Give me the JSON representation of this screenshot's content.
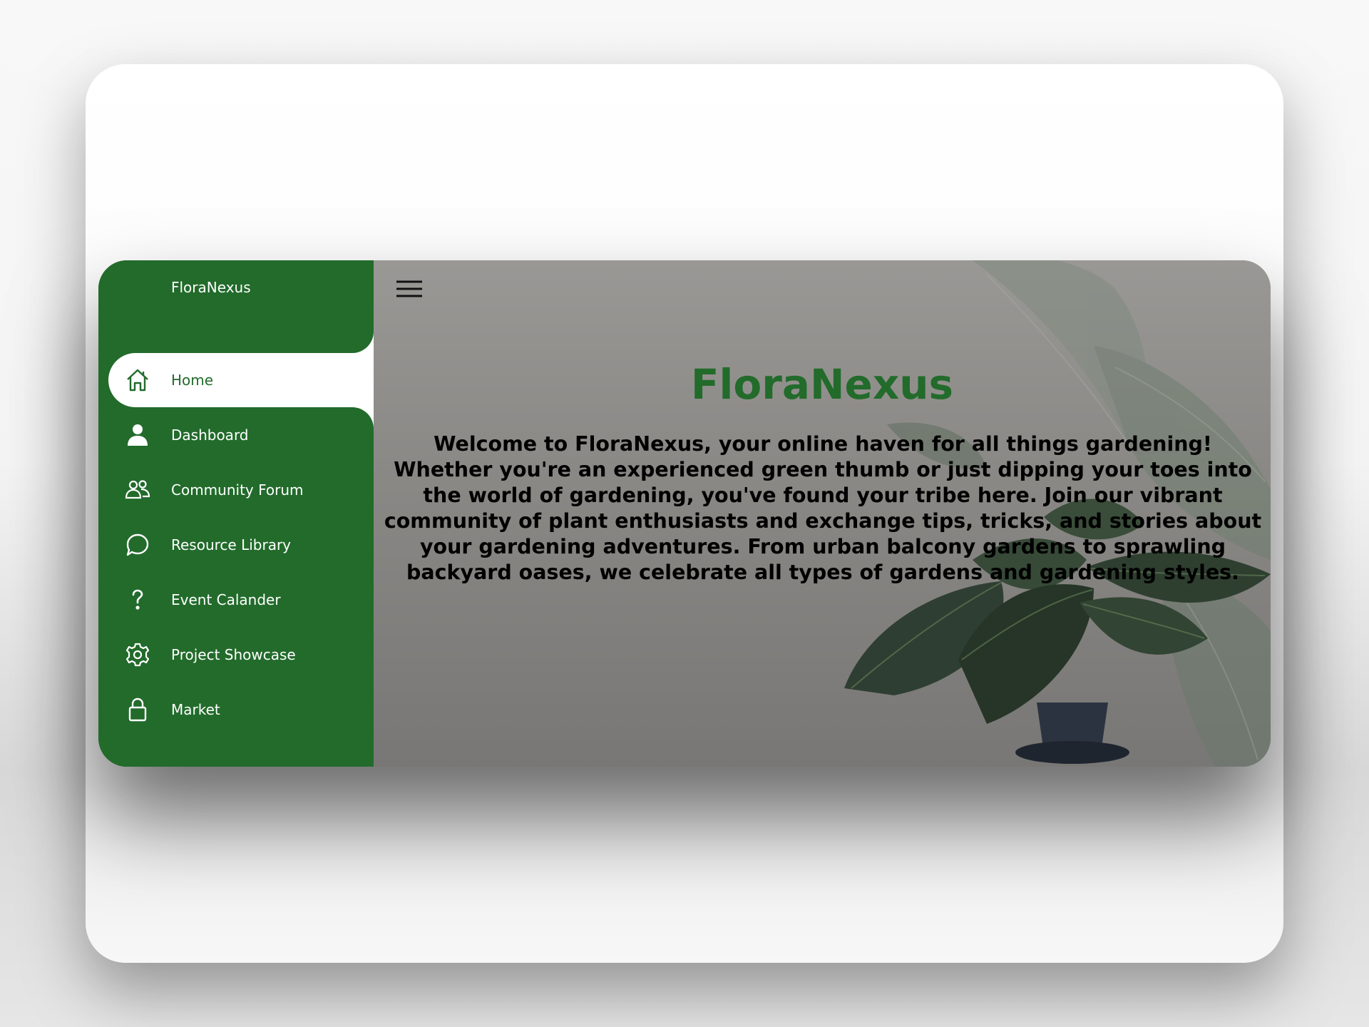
{
  "sidebar": {
    "brand": "FloraNexus",
    "items": [
      {
        "label": "Home",
        "icon": "home-icon",
        "active": true
      },
      {
        "label": "Dashboard",
        "icon": "user-icon",
        "active": false
      },
      {
        "label": "Community Forum",
        "icon": "users-icon",
        "active": false
      },
      {
        "label": "Resource Library",
        "icon": "chat-bubble-icon",
        "active": false
      },
      {
        "label": "Event Calander",
        "icon": "question-icon",
        "active": false
      },
      {
        "label": "Project Showcase",
        "icon": "gear-icon",
        "active": false
      },
      {
        "label": "Market",
        "icon": "lock-icon",
        "active": false
      }
    ]
  },
  "main": {
    "menu_icon": "hamburger-menu-icon",
    "title": "FloraNexus",
    "description": "Welcome to FloraNexus, your online haven for all things gardening! Whether you're an experienced green thumb or just dipping your toes into the world of gardening, you've found your tribe here. Join our vibrant community of plant enthusiasts and exchange tips, tricks, and stories about your gardening adventures. From urban balcony gardens to sprawling backyard oases, we celebrate all types of gardens and gardening styles."
  },
  "colors": {
    "brand_green": "#226b2b",
    "background_overlay": "#8b8986",
    "text_dark": "#000000",
    "text_light": "#ffffff"
  }
}
